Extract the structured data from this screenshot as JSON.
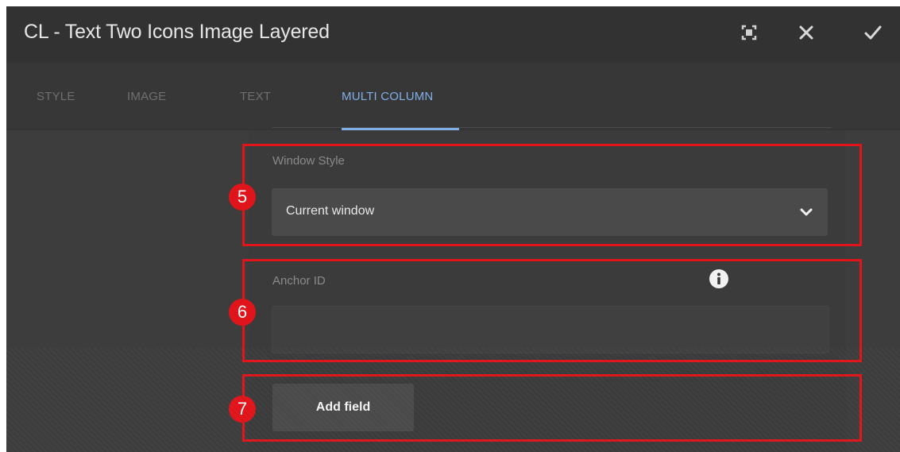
{
  "dialog": {
    "title": "CL - Text Two Icons Image Layered",
    "buttons": [
      {
        "icon": "fullscreen-icon"
      },
      {
        "icon": "close-icon"
      },
      {
        "icon": "checkmark-icon"
      }
    ]
  },
  "tabs": [
    {
      "label": "STYLE",
      "active": false
    },
    {
      "label": "IMAGE",
      "active": false
    },
    {
      "label": "TEXT",
      "active": false
    },
    {
      "label": "MULTI COLUMN",
      "active": true
    }
  ],
  "fields": {
    "window_style": {
      "label": "Window Style",
      "value": "Current window"
    },
    "anchor_id": {
      "label": "Anchor ID",
      "value": "",
      "info_icon": "info-icon"
    },
    "add_field_button": {
      "label": "Add field"
    }
  },
  "callouts": [
    {
      "number": "5"
    },
    {
      "number": "6"
    },
    {
      "number": "7"
    }
  ],
  "colors": {
    "dialog_bg": "#3d3d3d",
    "titlebar_bg": "#323232",
    "active_tab": "#82aee8",
    "callout_red": "#e0141b"
  }
}
